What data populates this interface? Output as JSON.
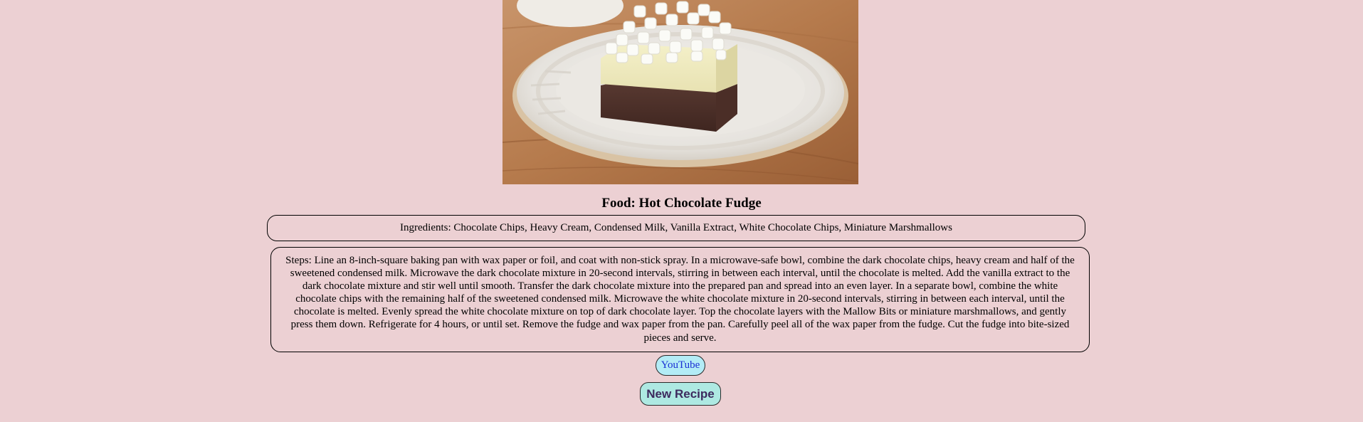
{
  "recipe": {
    "image_alt": "Hot Chocolate Fudge",
    "title_prefix": "Food:",
    "title_name": "Hot Chocolate Fudge",
    "ingredients_text": "Ingredients: Chocolate Chips, Heavy Cream, Condensed Milk, Vanilla Extract, White Chocolate Chips, Miniature Marshmallows",
    "steps_text": "Steps: Line an 8-inch-square baking pan with wax paper or foil, and coat with non-stick spray. In a microwave-safe bowl, combine the dark chocolate chips, heavy cream and half of the sweetened condensed milk. Microwave the dark chocolate mixture in 20-second intervals, stirring in between each interval, until the chocolate is melted. Add the vanilla extract to the dark chocolate mixture and stir well until smooth. Transfer the dark chocolate mixture into the prepared pan and spread into an even layer. In a separate bowl, combine the white chocolate chips with the remaining half of the sweetened condensed milk. Microwave the white chocolate mixture in 20-second intervals, stirring in between each interval, until the chocolate is melted. Evenly spread the white chocolate mixture on top of dark chocolate layer. Top the chocolate layers with the Mallow Bits or miniature marshmallows, and gently press them down. Refrigerate for 4 hours, or until set. Remove the fudge and wax paper from the pan. Carefully peel all of the wax paper from the fudge. Cut the fudge into bite-sized pieces and serve."
  },
  "buttons": {
    "youtube_label": "YouTube",
    "new_recipe_label": "New Recipe"
  },
  "colors": {
    "page_background": "#ecd0d3",
    "youtube_button_bg": "#b3ecf6",
    "new_recipe_button_bg": "#aee9e2"
  }
}
